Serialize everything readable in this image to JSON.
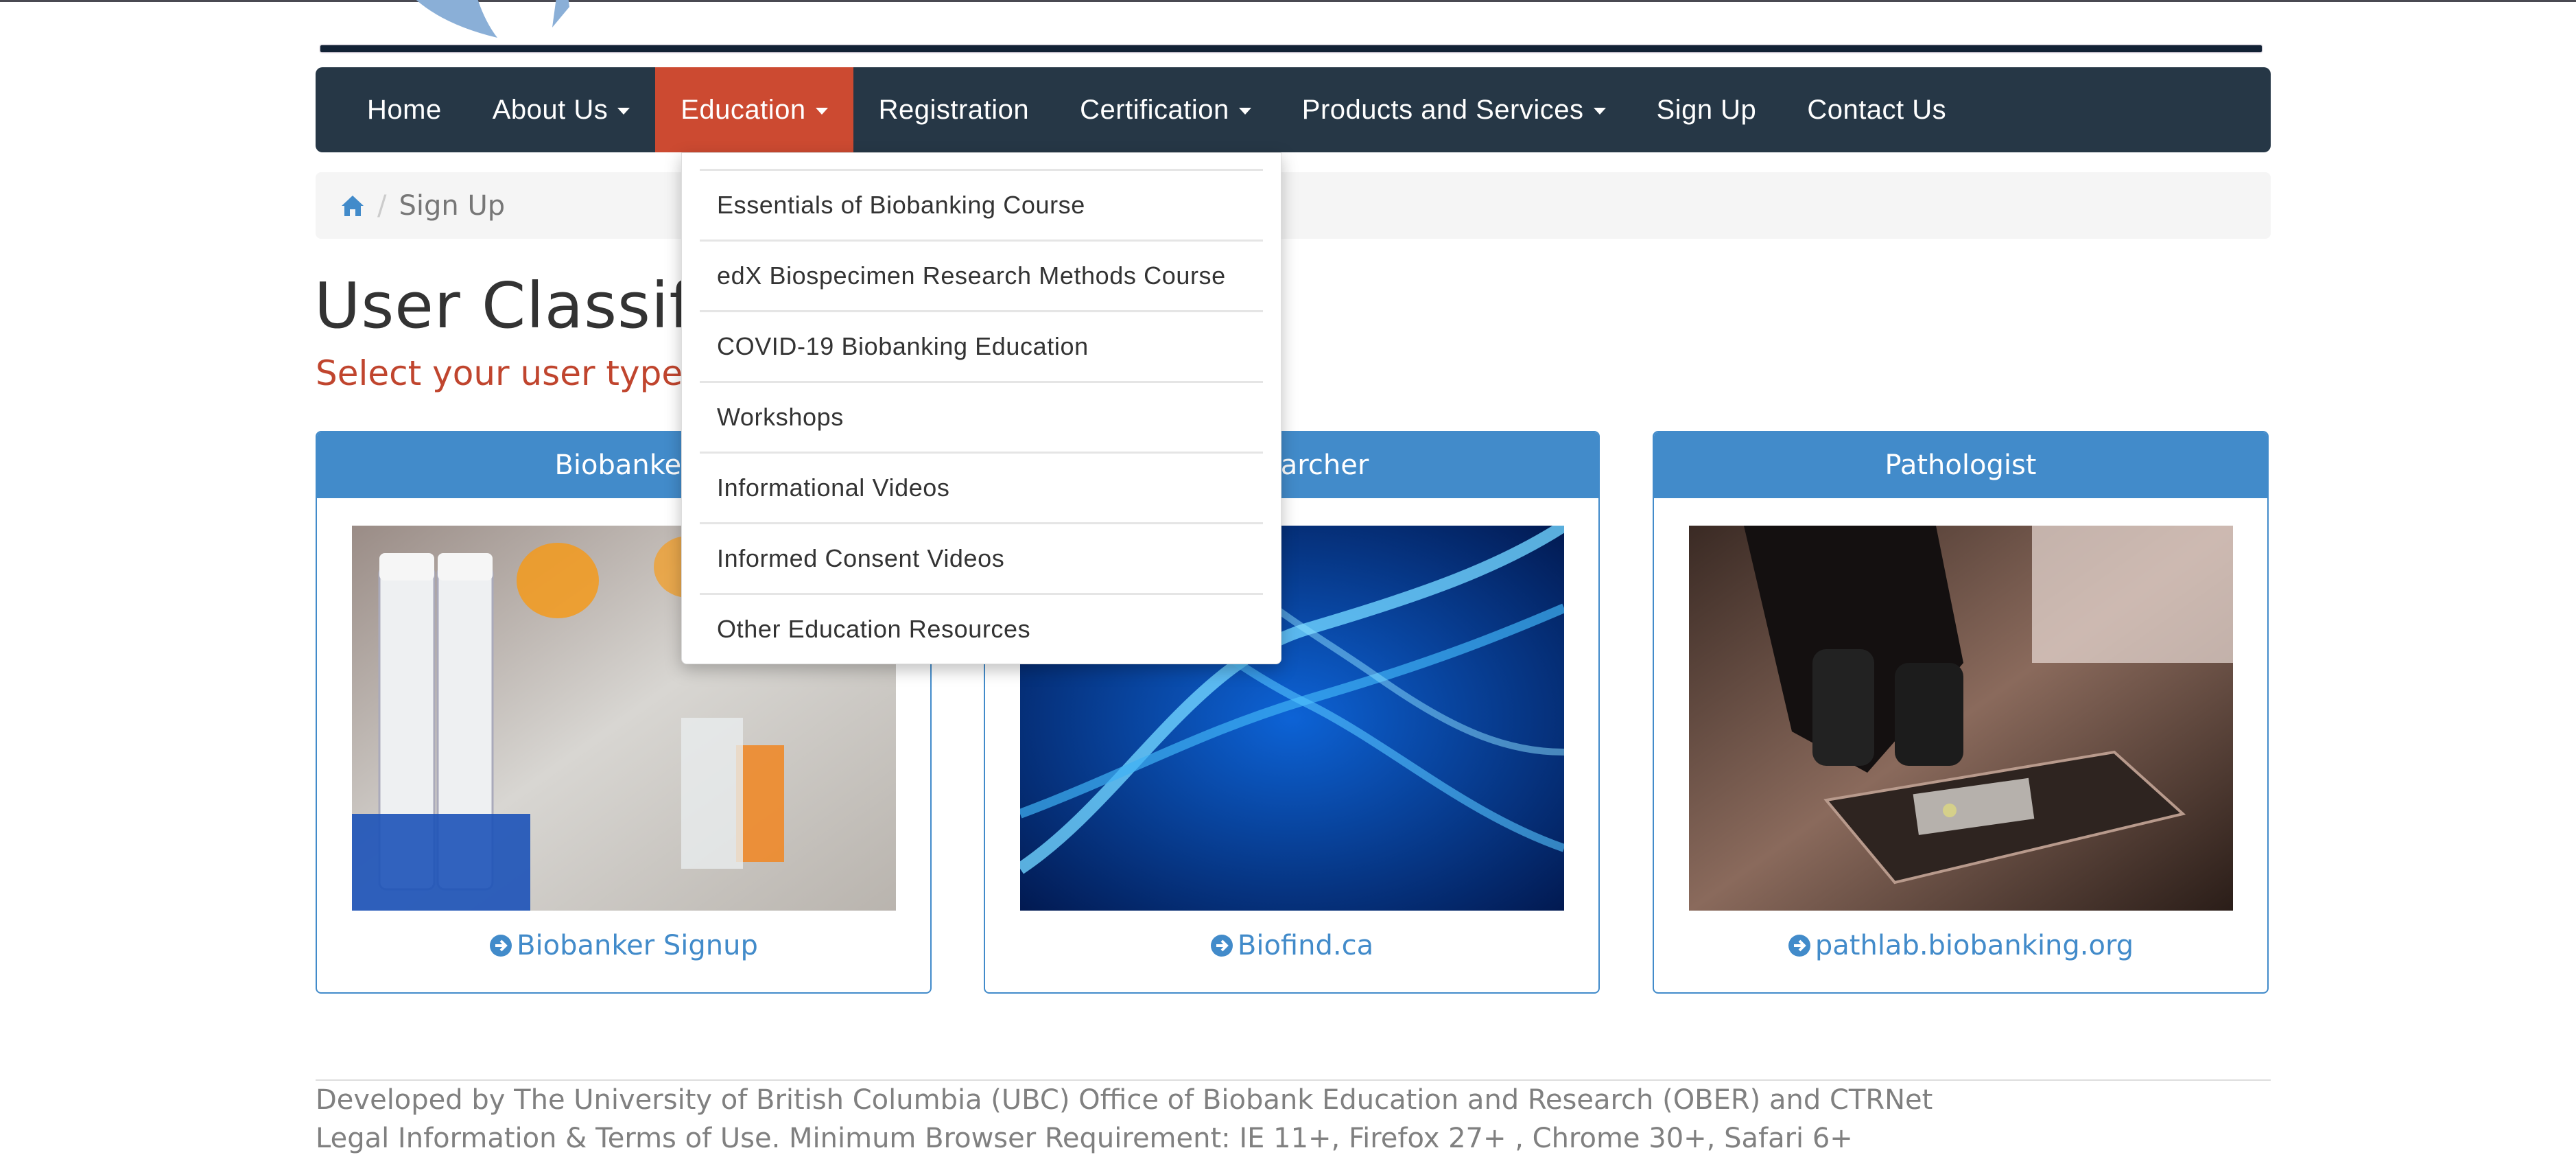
{
  "colors": {
    "nav_bg": "#263746",
    "nav_active_bg": "#cc4a31",
    "card_accent": "#428bca",
    "subtitle": "#c0452e",
    "footer_text": "#808080"
  },
  "nav": {
    "items": [
      {
        "label": "Home",
        "has_caret": false,
        "active": false
      },
      {
        "label": "About Us",
        "has_caret": true,
        "active": false
      },
      {
        "label": "Education",
        "has_caret": true,
        "active": true
      },
      {
        "label": "Registration",
        "has_caret": false,
        "active": false
      },
      {
        "label": "Certification",
        "has_caret": true,
        "active": false
      },
      {
        "label": "Products and Services",
        "has_caret": true,
        "active": false
      },
      {
        "label": "Sign Up",
        "has_caret": false,
        "active": false
      },
      {
        "label": "Contact Us",
        "has_caret": false,
        "active": false
      }
    ]
  },
  "education_dropdown": {
    "items": [
      "Essentials of Biobanking Course",
      "edX Biospecimen Research Methods Course",
      "COVID-19 Biobanking Education",
      "Workshops",
      "Informational Videos",
      "Informed Consent Videos",
      "Other Education Resources"
    ]
  },
  "breadcrumb": {
    "home_icon": "home-icon",
    "separator": "/",
    "current": "Sign Up"
  },
  "page": {
    "title": "User Classification",
    "subtitle": "Select your user type below"
  },
  "cards": [
    {
      "header": "Biobanker",
      "image": "lab-test-tubes-photo",
      "link_icon": "circle-arrow-right-icon",
      "link_label": "Biobanker Signup"
    },
    {
      "header": "Researcher",
      "image": "dna-helix-photo",
      "link_icon": "circle-arrow-right-icon",
      "link_label": "Biofind.ca"
    },
    {
      "header": "Pathologist",
      "image": "microscope-photo",
      "link_icon": "circle-arrow-right-icon",
      "link_label": "pathlab.biobanking.org"
    }
  ],
  "footer": {
    "line1": "Developed by  The University of British Columbia (UBC) Office of Biobank Education and Research (OBER) and CTRNet",
    "line2": "Legal Information & Terms of Use. Minimum Browser Requirement: IE 11+, Firefox 27+ , Chrome 30+, Safari 6+"
  }
}
